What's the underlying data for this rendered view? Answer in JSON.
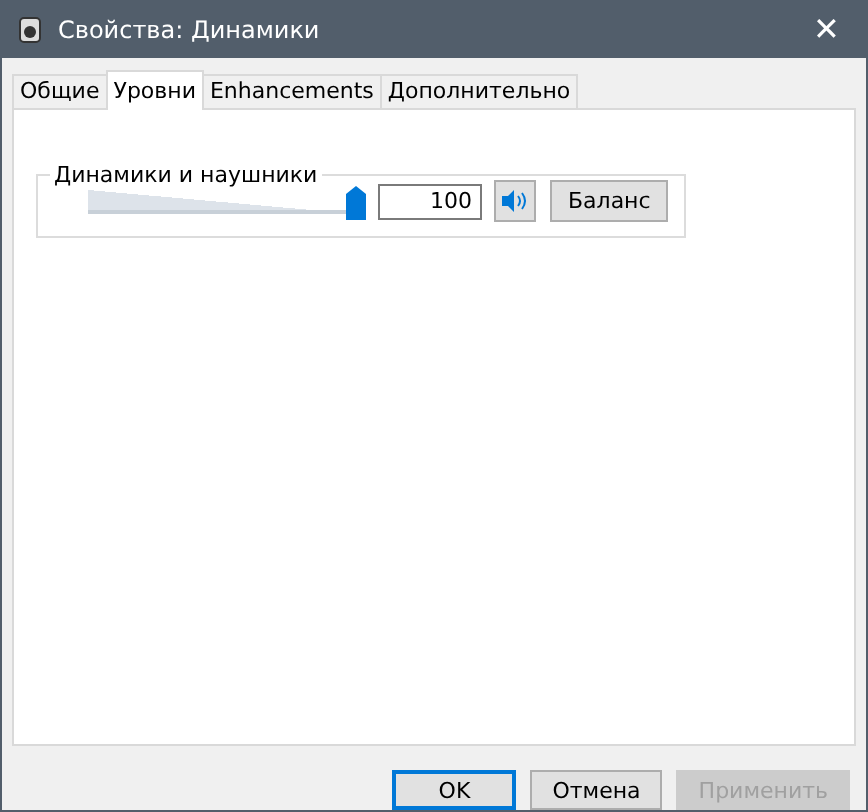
{
  "window": {
    "title": "Свойства: Динамики",
    "close": "✕"
  },
  "tabs": [
    {
      "label": "Общие",
      "selected": false
    },
    {
      "label": "Уровни",
      "selected": true
    },
    {
      "label": "Enhancements",
      "selected": false
    },
    {
      "label": "Дополнительно",
      "selected": false
    }
  ],
  "group": {
    "title": "Динамики и наушники",
    "level": 1,
    "value": "100",
    "muted": false,
    "balance": "Баланс"
  },
  "buttons": [
    {
      "label": "OK",
      "kind": "default",
      "disabled": false
    },
    {
      "label": "Отмена",
      "kind": "normal",
      "disabled": false
    },
    {
      "label": "Применить",
      "kind": "normal",
      "disabled": true
    }
  ]
}
